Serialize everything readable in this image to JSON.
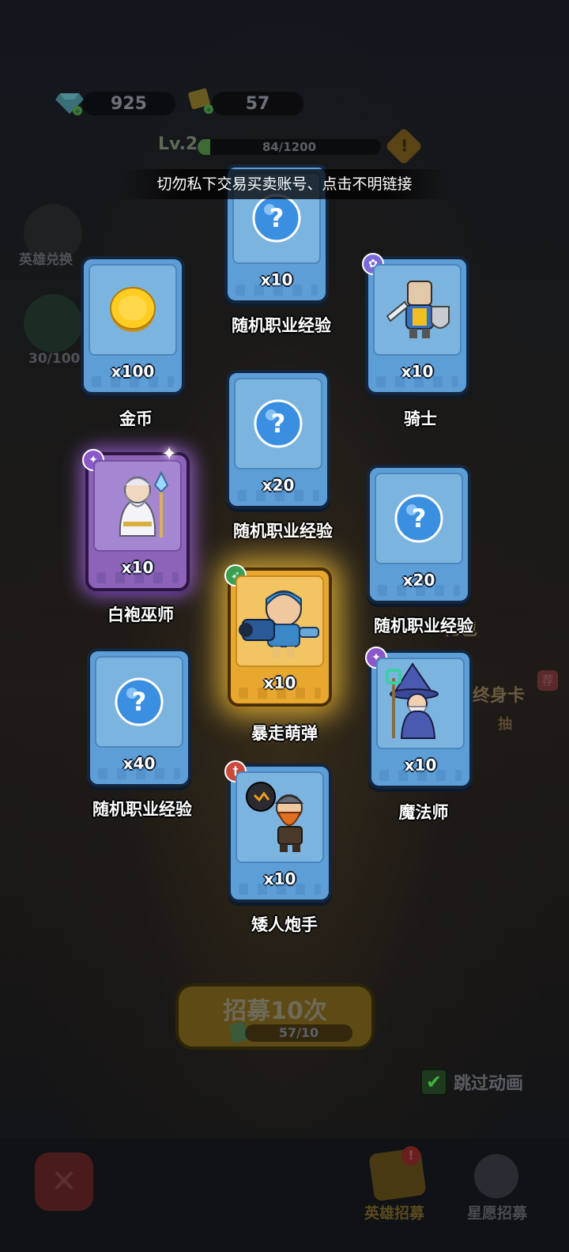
{
  "hud": {
    "diamonds": "925",
    "tickets": "57"
  },
  "level": {
    "label": "Lv.2",
    "xp": "84/1200",
    "progress": 0.07
  },
  "notice": "切勿私下交易买卖账号、点击不明链接",
  "side": {
    "hero_exchange": "英雄兑换",
    "progress": "30/100"
  },
  "cards": [
    {
      "qty": "x10",
      "name": "随机职业经验",
      "type": "exp"
    },
    {
      "qty": "x100",
      "name": "金币",
      "type": "coin"
    },
    {
      "qty": "x10",
      "name": "骑士",
      "type": "knight"
    },
    {
      "qty": "x20",
      "name": "随机职业经验",
      "type": "exp"
    },
    {
      "qty": "x10",
      "name": "白袍巫师",
      "type": "wizard-white"
    },
    {
      "qty": "x20",
      "name": "随机职业经验",
      "type": "exp"
    },
    {
      "qty": "x10",
      "name": "暴走萌弹",
      "type": "bomber"
    },
    {
      "qty": "x40",
      "name": "随机职业经验",
      "type": "exp"
    },
    {
      "qty": "x10",
      "name": "魔法师",
      "type": "mage"
    },
    {
      "qty": "x10",
      "name": "矮人炮手",
      "type": "dwarf"
    }
  ],
  "recruit": {
    "label": "招募10次",
    "count": "57/10"
  },
  "skip_animation": "跳过动画",
  "tabs": {
    "hero_recruit": "英雄招募",
    "star_recruit": "星愿招募"
  },
  "bg_labels": {
    "gift": "礼包",
    "lifetime_card": "终身卡",
    "recommend": "荐",
    "draw": "抽"
  },
  "colors": {
    "card_blue": "#5e9ed6",
    "card_purple": "#8c63b8",
    "card_gold": "#e8a830"
  }
}
